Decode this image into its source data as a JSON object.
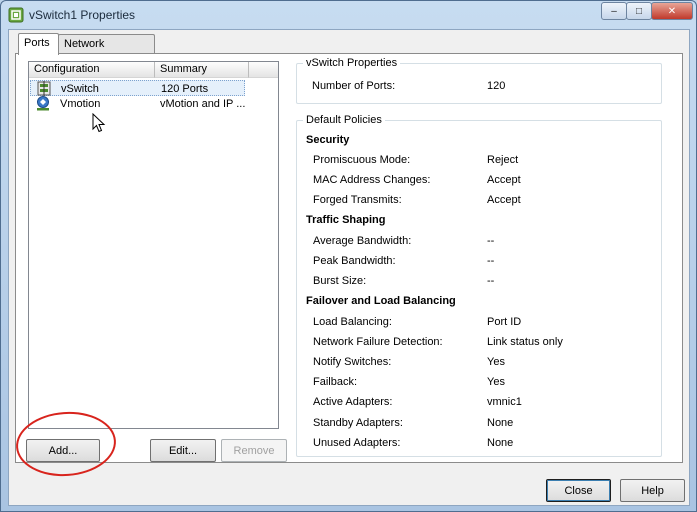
{
  "window": {
    "title": "vSwitch1 Properties",
    "controls": {
      "minimize": "–",
      "maximize": "□",
      "close": "✕"
    }
  },
  "tabs": [
    {
      "label": "Ports",
      "active": true
    },
    {
      "label": "Network Adapters",
      "active": false
    }
  ],
  "list": {
    "columns": [
      "Configuration",
      "Summary"
    ],
    "rows": [
      {
        "icon": "vswitch-icon",
        "configuration": "vSwitch",
        "summary": "120 Ports",
        "selected": true
      },
      {
        "icon": "vmkernel-port-icon",
        "configuration": "Vmotion",
        "summary": "vMotion and IP ...",
        "selected": false
      }
    ]
  },
  "list_buttons": {
    "add": "Add...",
    "edit": "Edit...",
    "remove": "Remove"
  },
  "vswitch_properties": {
    "title": "vSwitch Properties",
    "number_of_ports_label": "Number of Ports:",
    "number_of_ports_value": "120"
  },
  "default_policies": {
    "title": "Default Policies",
    "security": {
      "heading": "Security",
      "items": [
        {
          "label": "Promiscuous Mode:",
          "value": "Reject"
        },
        {
          "label": "MAC Address Changes:",
          "value": "Accept"
        },
        {
          "label": "Forged Transmits:",
          "value": "Accept"
        }
      ]
    },
    "traffic_shaping": {
      "heading": "Traffic Shaping",
      "items": [
        {
          "label": "Average Bandwidth:",
          "value": "--"
        },
        {
          "label": "Peak Bandwidth:",
          "value": "--"
        },
        {
          "label": "Burst Size:",
          "value": "--"
        }
      ]
    },
    "failover": {
      "heading": "Failover and Load Balancing",
      "items": [
        {
          "label": "Load Balancing:",
          "value": "Port ID"
        },
        {
          "label": "Network Failure Detection:",
          "value": "Link status only"
        },
        {
          "label": "Notify Switches:",
          "value": "Yes"
        },
        {
          "label": "Failback:",
          "value": "Yes"
        },
        {
          "label": "Active Adapters:",
          "value": "vmnic1"
        },
        {
          "label": "Standby Adapters:",
          "value": "None"
        },
        {
          "label": "Unused Adapters:",
          "value": "None"
        }
      ]
    }
  },
  "footer": {
    "close": "Close",
    "help": "Help"
  },
  "colors": {
    "annotation": "#d8241d",
    "selection": "#e5f0fb"
  }
}
